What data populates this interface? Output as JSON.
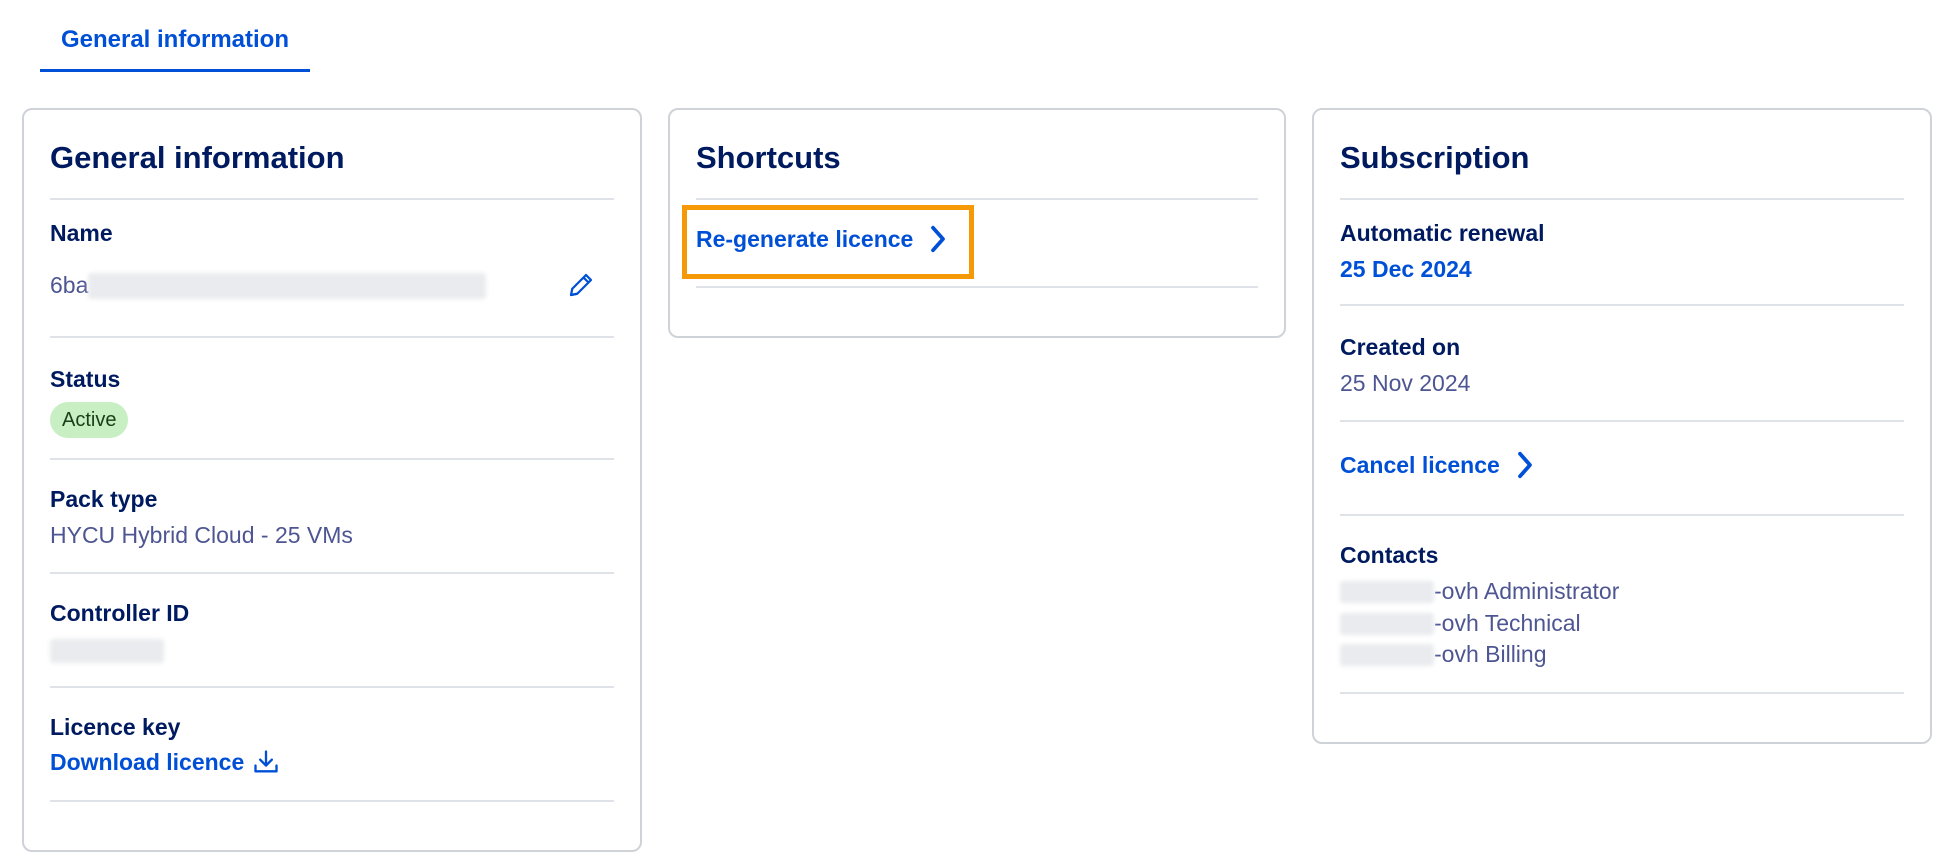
{
  "tabs": {
    "active_label": "General information"
  },
  "general": {
    "title": "General information",
    "name_label": "Name",
    "name_value_prefix": "6ba",
    "status_label": "Status",
    "status_value": "Active",
    "pack_label": "Pack type",
    "pack_value": "HYCU Hybrid Cloud - 25 VMs",
    "controller_label": "Controller ID",
    "licence_key_label": "Licence key",
    "download_link": "Download licence"
  },
  "shortcuts": {
    "title": "Shortcuts",
    "regenerate_link": "Re-generate licence"
  },
  "subscription": {
    "title": "Subscription",
    "renewal_label": "Automatic renewal",
    "renewal_value": "25 Dec 2024",
    "created_label": "Created on",
    "created_value": "25 Nov 2024",
    "cancel_link": "Cancel licence",
    "contacts_label": "Contacts",
    "contacts": [
      {
        "suffix": "-ovh Administrator"
      },
      {
        "suffix": "-ovh Technical"
      },
      {
        "suffix": "-ovh Billing"
      }
    ]
  },
  "colors": {
    "accent": "#0050d7",
    "highlight": "#f59a06",
    "status_active_bg": "#c8efc4"
  },
  "icons": {
    "edit": "pencil-icon",
    "download": "download-icon",
    "chevron": "chevron-right-icon"
  }
}
